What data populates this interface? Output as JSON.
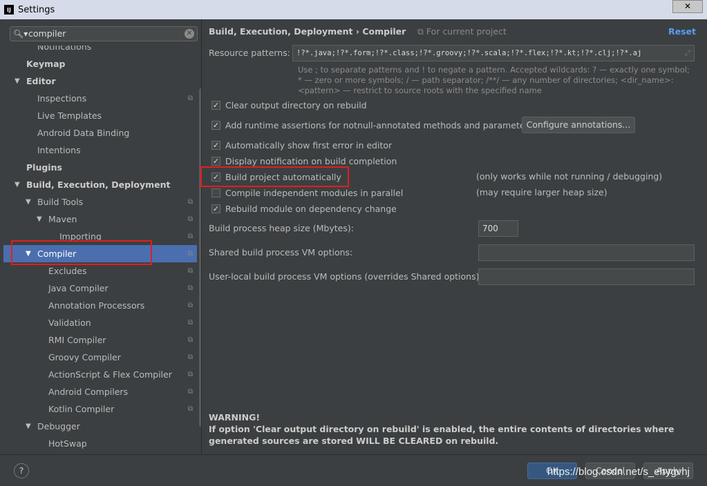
{
  "window": {
    "title": "Settings",
    "logo": "IJ",
    "close": "✕"
  },
  "search": {
    "value": "compiler"
  },
  "tree": [
    {
      "label": "Notifications",
      "level": 2,
      "bold": false,
      "arrow": "",
      "proj": false
    },
    {
      "label": "Keymap",
      "level": 1,
      "bold": true,
      "arrow": "",
      "proj": false
    },
    {
      "label": "Editor",
      "level": 1,
      "bold": true,
      "arrow": "▼",
      "proj": false
    },
    {
      "label": "Inspections",
      "level": 2,
      "bold": false,
      "arrow": "",
      "proj": true
    },
    {
      "label": "Live Templates",
      "level": 2,
      "bold": false,
      "arrow": "",
      "proj": false
    },
    {
      "label": "Android Data Binding",
      "level": 2,
      "bold": false,
      "arrow": "",
      "proj": false
    },
    {
      "label": "Intentions",
      "level": 2,
      "bold": false,
      "arrow": "",
      "proj": false
    },
    {
      "label": "Plugins",
      "level": 1,
      "bold": true,
      "arrow": "",
      "proj": false
    },
    {
      "label": "Build, Execution, Deployment",
      "level": 1,
      "bold": true,
      "arrow": "▼",
      "proj": false
    },
    {
      "label": "Build Tools",
      "level": 2,
      "bold": false,
      "arrow": "▼",
      "proj": true
    },
    {
      "label": "Maven",
      "level": 3,
      "bold": false,
      "arrow": "▼",
      "proj": true
    },
    {
      "label": "Importing",
      "level": 4,
      "bold": false,
      "arrow": "",
      "proj": true
    },
    {
      "label": "Compiler",
      "level": 2,
      "bold": false,
      "arrow": "▼",
      "proj": true,
      "selected": true
    },
    {
      "label": "Excludes",
      "level": 3,
      "bold": false,
      "arrow": "",
      "proj": true
    },
    {
      "label": "Java Compiler",
      "level": 3,
      "bold": false,
      "arrow": "",
      "proj": true
    },
    {
      "label": "Annotation Processors",
      "level": 3,
      "bold": false,
      "arrow": "",
      "proj": true
    },
    {
      "label": "Validation",
      "level": 3,
      "bold": false,
      "arrow": "",
      "proj": true
    },
    {
      "label": "RMI Compiler",
      "level": 3,
      "bold": false,
      "arrow": "",
      "proj": true
    },
    {
      "label": "Groovy Compiler",
      "level": 3,
      "bold": false,
      "arrow": "",
      "proj": true
    },
    {
      "label": "ActionScript & Flex Compiler",
      "level": 3,
      "bold": false,
      "arrow": "",
      "proj": true
    },
    {
      "label": "Android Compilers",
      "level": 3,
      "bold": false,
      "arrow": "",
      "proj": true
    },
    {
      "label": "Kotlin Compiler",
      "level": 3,
      "bold": false,
      "arrow": "",
      "proj": true
    },
    {
      "label": "Debugger",
      "level": 2,
      "bold": false,
      "arrow": "▼",
      "proj": false
    },
    {
      "label": "HotSwap",
      "level": 3,
      "bold": false,
      "arrow": "",
      "proj": false
    }
  ],
  "main": {
    "breadcrumb": "Build, Execution, Deployment  ›  Compiler",
    "for_project": "⧉ For current project",
    "reset": "Reset",
    "resource_label": "Resource patterns:",
    "resource_value": "!?*.java;!?*.form;!?*.class;!?*.groovy;!?*.scala;!?*.flex;!?*.kt;!?*.clj;!?*.aj",
    "hint": "Use ; to separate patterns and ! to negate a pattern. Accepted wildcards: ? — exactly one symbol; * — zero or more symbols; / — path separator; /**/ — any number of directories; <dir_name>:<pattern> — restrict to source roots with the specified name",
    "checkboxes": [
      {
        "label": "Clear output directory on rebuild",
        "checked": true
      },
      {
        "label": "Add runtime assertions for notnull-annotated methods and parameters",
        "checked": true
      },
      {
        "label": "Automatically show first error in editor",
        "checked": true
      },
      {
        "label": "Display notification on build completion",
        "checked": true
      },
      {
        "label": "Build project automatically",
        "checked": true
      },
      {
        "label": "Compile independent modules in parallel",
        "checked": false
      },
      {
        "label": "Rebuild module on dependency change",
        "checked": true
      }
    ],
    "configure_annotations": "Configure annotations...",
    "note_auto": "(only works while not running / debugging)",
    "note_parallel": "(may require larger heap size)",
    "heap_label": "Build process heap size (Mbytes):",
    "heap_value": "700",
    "shared_label": "Shared build process VM options:",
    "shared_value": "",
    "user_label": "User-local build process VM options (overrides Shared options):",
    "user_value": "",
    "warning_title": "WARNING!",
    "warning_text": "If option 'Clear output directory on rebuild' is enabled, the entire contents of directories where generated sources are stored WILL BE CLEARED on rebuild."
  },
  "footer": {
    "help": "?",
    "ok": "OK",
    "cancel": "Cancel",
    "apply": "Apply",
    "watermark": "https://blog.csdn.net/s_ehygvhj"
  },
  "colors": {
    "selection": "#4b6eaf",
    "highlight": "#e0201c",
    "link": "#589df6"
  }
}
